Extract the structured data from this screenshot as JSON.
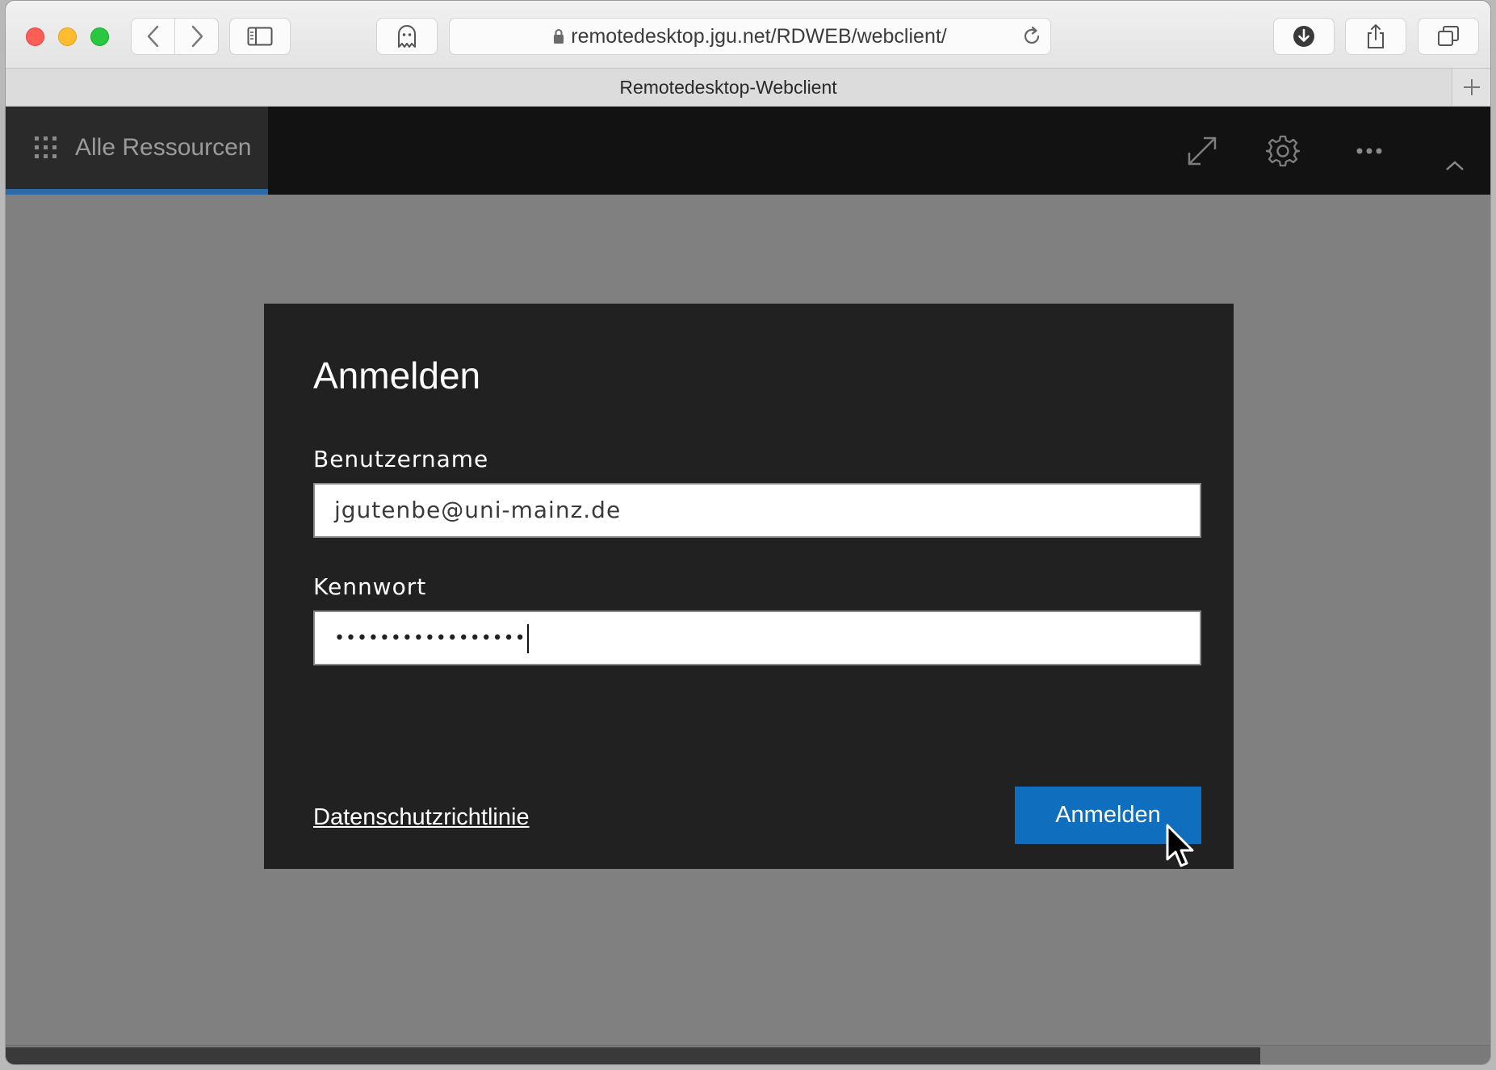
{
  "browser": {
    "url": "remotedesktop.jgu.net/RDWEB/webclient/",
    "tab_title": "Remotedesktop-Webclient",
    "icons": [
      "close-window-icon",
      "minimize-window-icon",
      "zoom-window-icon",
      "back-icon",
      "forward-icon",
      "sidebar-icon",
      "ghost-icon",
      "lock-icon",
      "reload-icon",
      "download-icon",
      "share-icon",
      "tabs-overview-icon",
      "new-tab-icon"
    ]
  },
  "app": {
    "resources_tab_label": "Alle Ressourcen",
    "icons": [
      "app-grid-icon",
      "fullscreen-icon",
      "gear-icon",
      "more-icon",
      "chevron-up-icon"
    ],
    "accent_color": "#2b6aa6"
  },
  "login": {
    "title": "Anmelden",
    "username_label": "Benutzername",
    "username_value": "jgutenbe@uni-mainz.de",
    "password_label": "Kennwort",
    "password_masked": "•••••••••••••••••",
    "privacy_link": "Datenschutzrichtlinie",
    "submit_label": "Anmelden",
    "submit_color": "#106ebe"
  }
}
